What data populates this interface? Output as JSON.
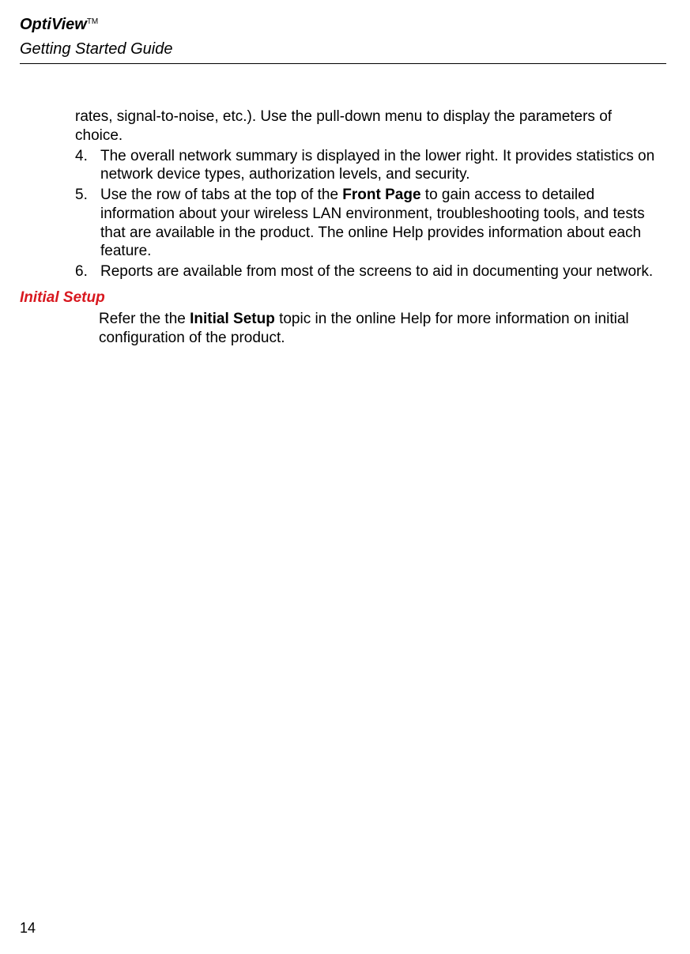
{
  "header": {
    "product_title": "OptiView",
    "tm": "TM",
    "subtitle": "Getting Started Guide"
  },
  "continued": "rates, signal-to-noise, etc.). Use the pull-down menu to display the parameters of choice.",
  "items": [
    {
      "num": "4.",
      "text": "The overall network summary is displayed in the lower right. It provides statistics on  network device types, authorization levels, and security."
    },
    {
      "num": "5.",
      "before": "Use the row of tabs at the top of the ",
      "bold": "Front Page",
      "after": " to gain access to detailed information about your wireless LAN environment, troubleshooting tools, and tests that are available in the product. The online Help provides information about each feature."
    },
    {
      "num": "6.",
      "text": "Reports are available from most of the screens to aid in documenting your network."
    }
  ],
  "section": {
    "heading": "Initial Setup",
    "before": "Refer the the ",
    "bold": "Initial Setup",
    "after": " topic in the online Help for more information on initial configuration of the product."
  },
  "page_number": "14"
}
